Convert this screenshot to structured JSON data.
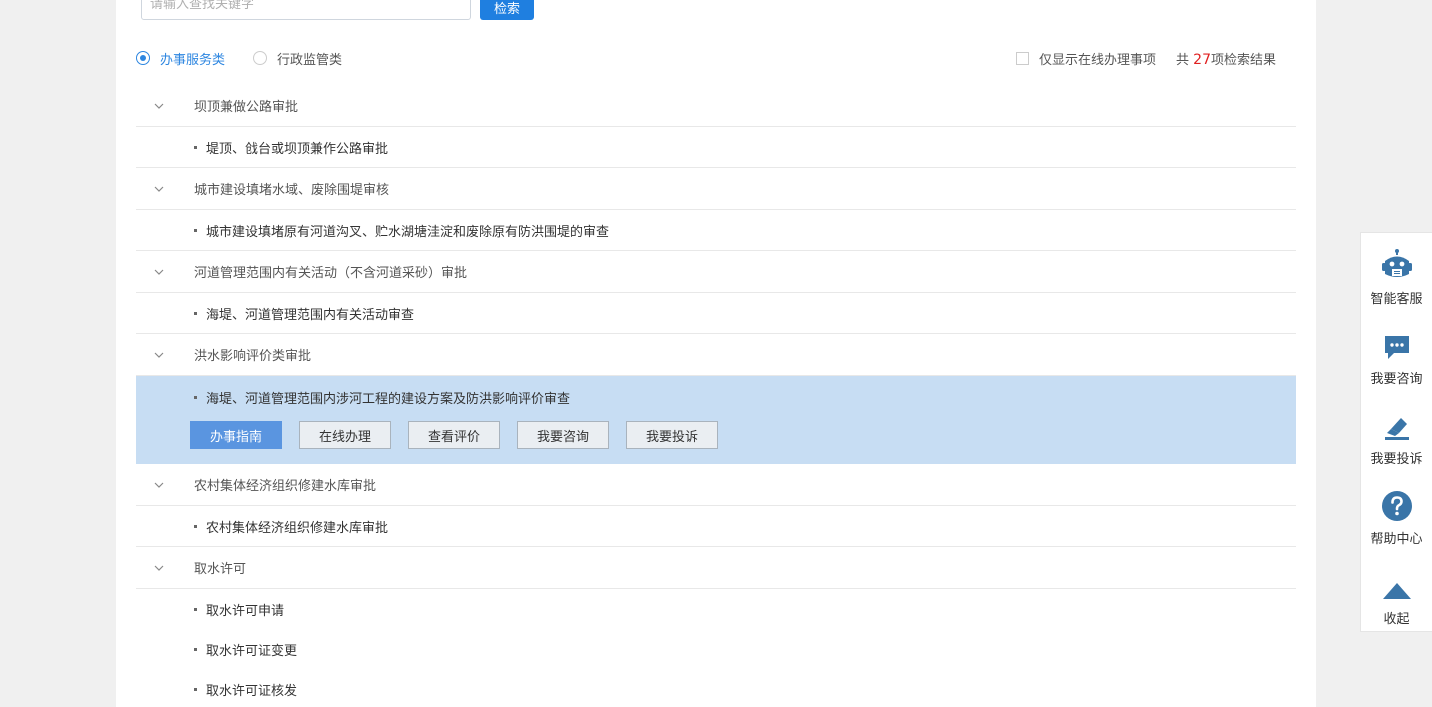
{
  "search": {
    "placeholder": "请输入查找关键字",
    "button": "检索"
  },
  "categories": [
    {
      "label": "办事服务类",
      "active": true
    },
    {
      "label": "行政监管类",
      "active": false
    }
  ],
  "filter": {
    "online_only_label": "仅显示在线办理事项",
    "count_prefix": "共 ",
    "count": "27",
    "count_suffix": "项检索结果"
  },
  "groups": [
    {
      "title": "坝顶兼做公路审批",
      "items": [
        "堤顶、戗台或坝顶兼作公路审批"
      ]
    },
    {
      "title": "城市建设填堵水域、废除围堤审核",
      "items": [
        "城市建设填堵原有河道沟叉、贮水湖塘洼淀和废除原有防洪围堤的审查"
      ]
    },
    {
      "title": "河道管理范围内有关活动（不含河道采砂）审批",
      "items": [
        "海堤、河道管理范围内有关活动审查"
      ]
    },
    {
      "title": "洪水影响评价类审批",
      "items": [
        "海堤、河道管理范围内涉河工程的建设方案及防洪影响评价审查"
      ]
    },
    {
      "title": "农村集体经济组织修建水库审批",
      "items": [
        "农村集体经济组织修建水库审批"
      ]
    },
    {
      "title": "取水许可",
      "items": [
        "取水许可申请",
        "取水许可证变更",
        "取水许可证核发"
      ]
    }
  ],
  "actions": [
    "办事指南",
    "在线办理",
    "查看评价",
    "我要咨询",
    "我要投诉"
  ],
  "float_bar": [
    "智能客服",
    "我要咨询",
    "我要投诉",
    "帮助中心",
    "收起"
  ],
  "colors": {
    "accent": "#1f7fe0",
    "selected_bg": "#c7ddf3",
    "primary_action": "#5a95e0",
    "count": "#e02020",
    "icon": "#3a75a8"
  }
}
